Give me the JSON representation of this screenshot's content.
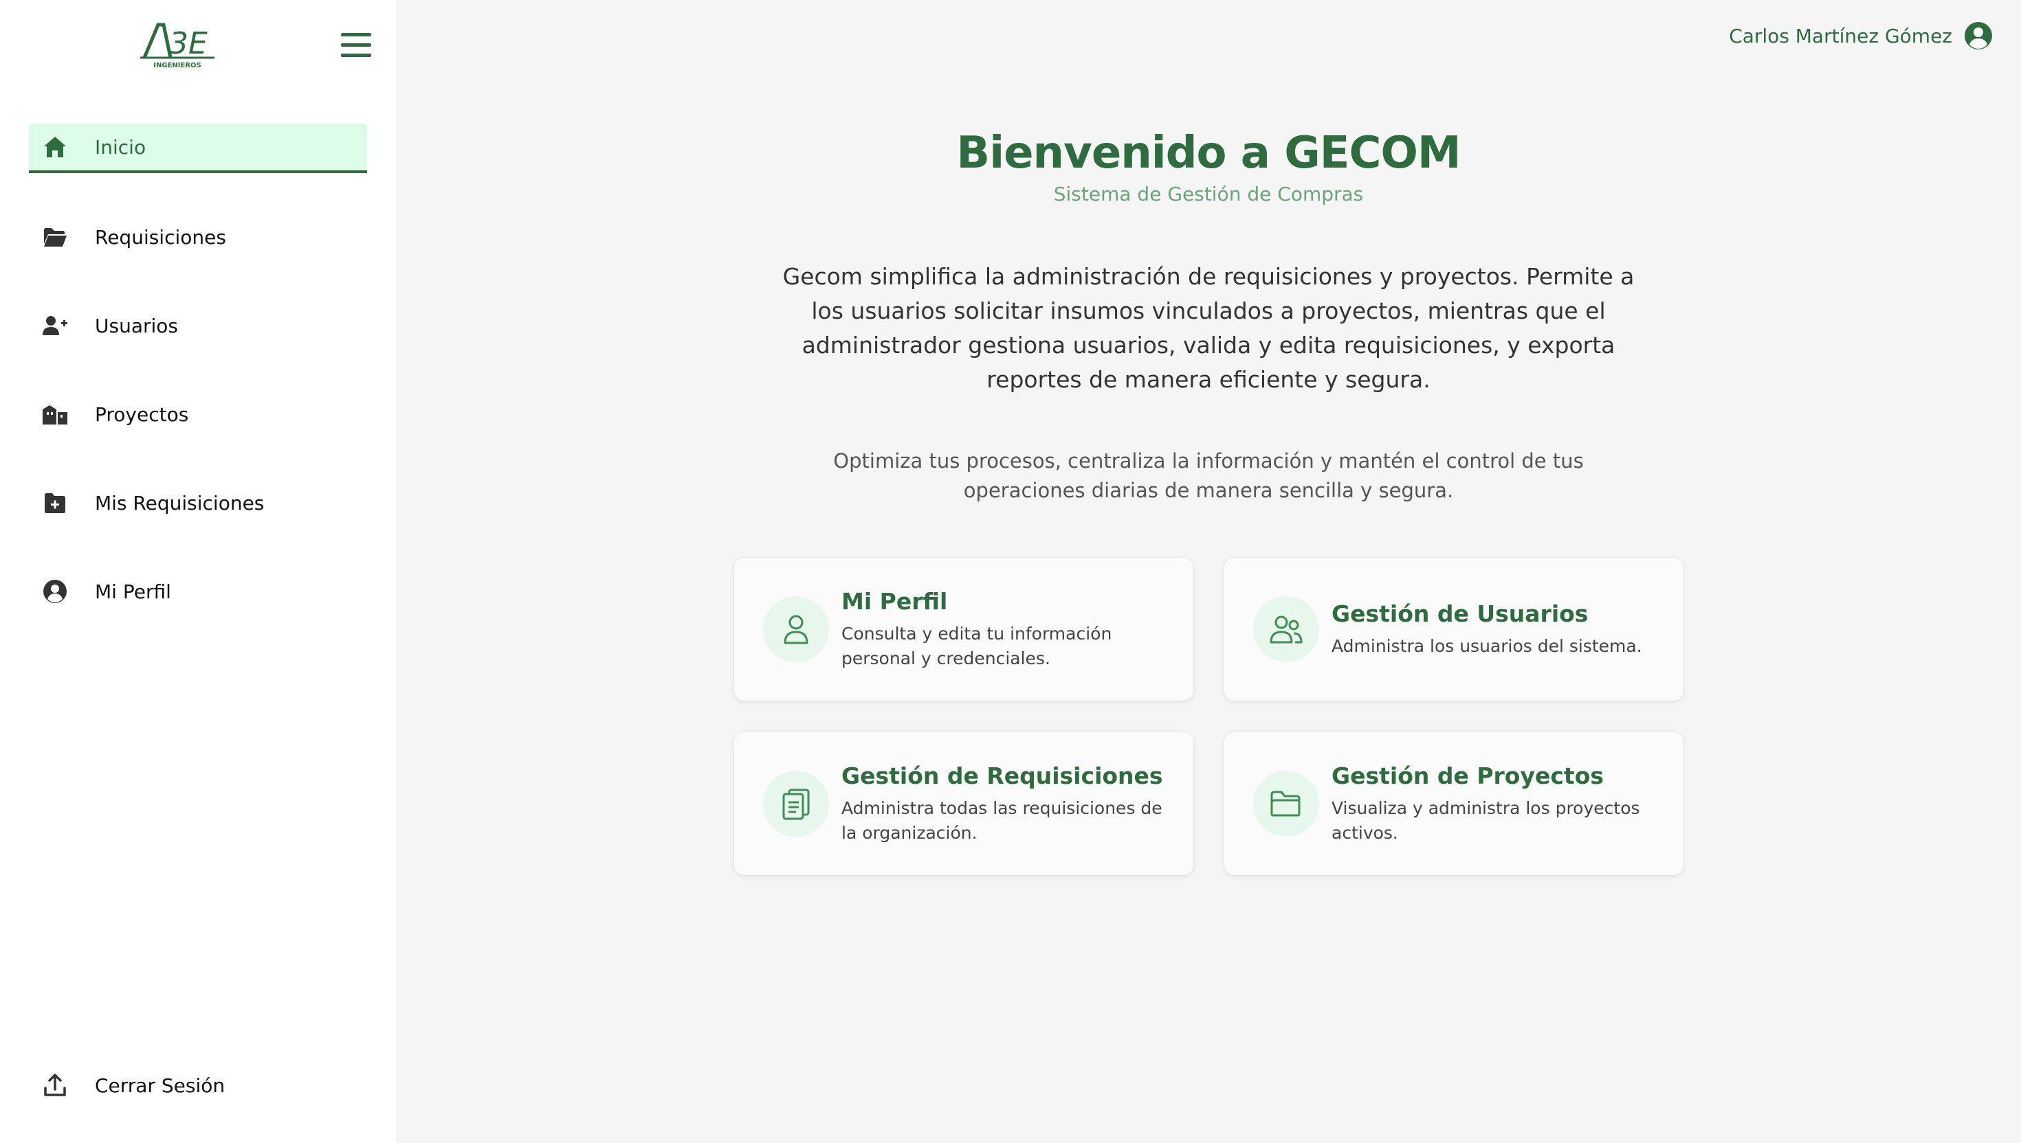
{
  "brand": {
    "logo_text": "ABE",
    "logo_subtext": "INGENIEROS",
    "accent_color": "#2e6b3f"
  },
  "sidebar": {
    "items": [
      {
        "label": "Inicio",
        "icon": "home-icon",
        "active": true
      },
      {
        "label": "Requisiciones",
        "icon": "folder-open-icon",
        "active": false
      },
      {
        "label": "Usuarios",
        "icon": "user-plus-icon",
        "active": false
      },
      {
        "label": "Proyectos",
        "icon": "city-icon",
        "active": false
      },
      {
        "label": "Mis Requisiciones",
        "icon": "folder-plus-icon",
        "active": false
      },
      {
        "label": "Mi Perfil",
        "icon": "user-circle-icon",
        "active": false
      }
    ],
    "logout_label": "Cerrar Sesión"
  },
  "header": {
    "user_name": "Carlos Martínez Gómez"
  },
  "main": {
    "title": "Bienvenido a GECOM",
    "subtitle": "Sistema de Gestión de Compras",
    "intro": "Gecom simplifica la administración de requisiciones y proyectos. Permite a los usuarios solicitar insumos vinculados a proyectos, mientras que el administrador gestiona usuarios, valida y edita requisiciones, y exporta reportes de manera eficiente y segura.",
    "note": "Optimiza tus procesos, centraliza la información y mantén el control de tus operaciones diarias de manera sencilla y segura.",
    "cards": [
      {
        "title": "Mi Perfil",
        "desc": "Consulta y edita tu información personal y credenciales.",
        "icon": "user-icon"
      },
      {
        "title": "Gestión de Usuarios",
        "desc": "Administra los usuarios del sistema.",
        "icon": "users-icon"
      },
      {
        "title": "Gestión de Requisiciones",
        "desc": "Administra todas las requisiciones de la organización.",
        "icon": "clipboard-icon"
      },
      {
        "title": "Gestión de Proyectos",
        "desc": "Visualiza y administra los proyectos activos.",
        "icon": "folder-icon"
      }
    ]
  }
}
